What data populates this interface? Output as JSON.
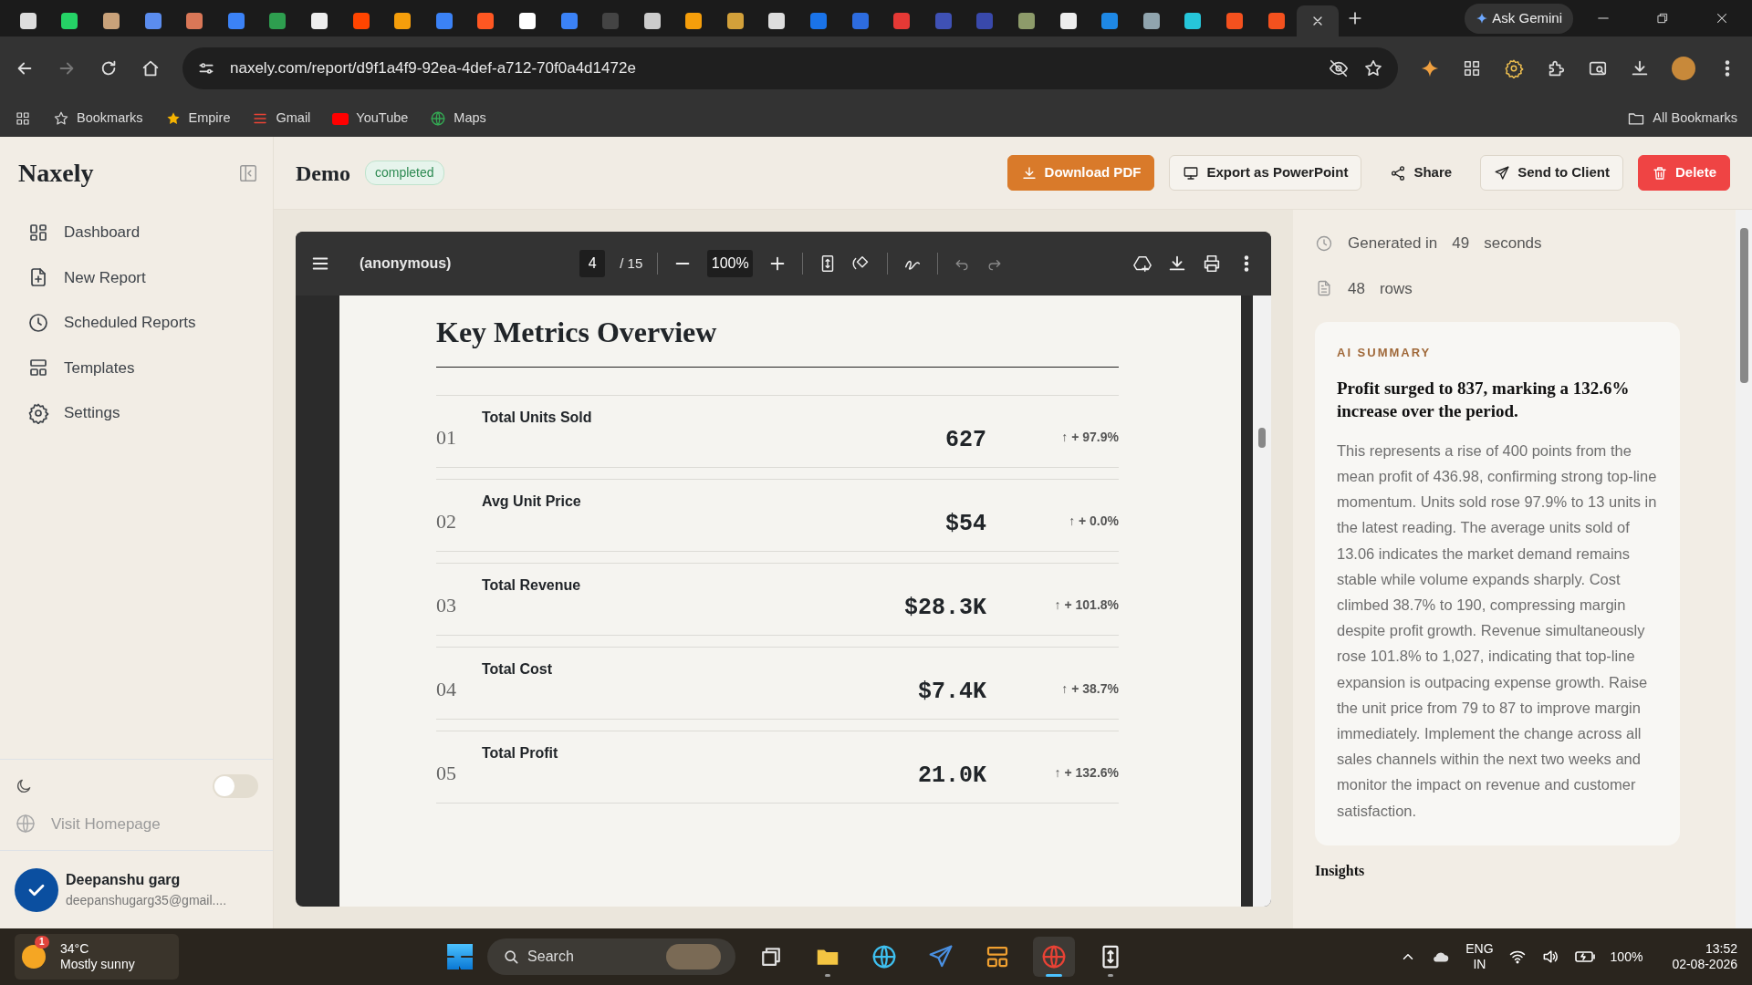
{
  "browser": {
    "tabs": [
      {
        "selected": false
      },
      {
        "selected": false
      },
      {
        "selected": false
      },
      {
        "selected": false
      },
      {
        "selected": false
      },
      {
        "selected": false
      },
      {
        "selected": false
      },
      {
        "selected": false
      },
      {
        "selected": false
      },
      {
        "selected": false
      },
      {
        "selected": false
      },
      {
        "selected": false
      },
      {
        "selected": false
      },
      {
        "selected": false
      },
      {
        "selected": false
      },
      {
        "selected": false
      },
      {
        "selected": false
      },
      {
        "selected": false
      },
      {
        "selected": false
      },
      {
        "selected": false
      },
      {
        "selected": false
      },
      {
        "selected": false
      },
      {
        "selected": false
      },
      {
        "selected": false
      },
      {
        "selected": false
      },
      {
        "selected": false
      },
      {
        "selected": false
      },
      {
        "selected": false
      },
      {
        "selected": false
      },
      {
        "selected": false
      },
      {
        "selected": false
      },
      {
        "selected": true
      }
    ],
    "gemini_button": "Ask Gemini",
    "url": "naxely.com/report/d9f1a4f9-92ea-4def-a712-70f0a4d1472e",
    "bookmarks": [
      "Bookmarks",
      "Empire",
      "Gmail",
      "YouTube",
      "Maps"
    ],
    "all_bookmarks": "All Bookmarks"
  },
  "sidebar": {
    "brand": "Naxely",
    "items": [
      {
        "label": "Dashboard",
        "selected": false
      },
      {
        "label": "New Report",
        "selected": false
      },
      {
        "label": "Scheduled Reports",
        "selected": false
      },
      {
        "label": "Templates",
        "selected": false
      },
      {
        "label": "Settings",
        "selected": false
      }
    ],
    "dark_mode": {
      "on": false
    },
    "visit_homepage": "Visit Homepage",
    "user": {
      "name": "Deepanshu garg",
      "email": "deepanshugarg35@gmail...."
    }
  },
  "header": {
    "title": "Demo",
    "status": "completed",
    "actions": [
      {
        "label": "Download PDF",
        "kind": "primary"
      },
      {
        "label": "Export as PowerPoint",
        "kind": "outline"
      },
      {
        "label": "Share",
        "kind": "plain"
      },
      {
        "label": "Send to Client",
        "kind": "outline"
      },
      {
        "label": "Delete",
        "kind": "danger"
      }
    ]
  },
  "pdf_viewer": {
    "title": "(anonymous)",
    "page": "4",
    "page_count": "/ 15",
    "zoom": "100%",
    "page_content": {
      "heading": "Key Metrics Overview",
      "metrics": [
        {
          "index": "01",
          "label": "Total Units Sold",
          "value": "627",
          "change": "↑ + 97.9%"
        },
        {
          "index": "02",
          "label": "Avg Unit Price",
          "value": "$54",
          "change": "↑ + 0.0%"
        },
        {
          "index": "03",
          "label": "Total Revenue",
          "value": "$28.3K",
          "change": "↑ + 101.8%"
        },
        {
          "index": "04",
          "label": "Total Cost",
          "value": "$7.4K",
          "change": "↑ + 38.7%"
        },
        {
          "index": "05",
          "label": "Total Profit",
          "value": "21.0K",
          "change": "↑ + 132.6%"
        }
      ]
    }
  },
  "details": {
    "generated": {
      "label": "Generated in",
      "value": "49",
      "unit": "seconds"
    },
    "rows": {
      "value": "48",
      "unit": "rows"
    },
    "summary": {
      "label": "AI SUMMARY",
      "headline": "Profit surged to 837, marking a 132.6% increase over the period.",
      "body": "This represents a rise of 400 points from the mean profit of 436.98, confirming strong top-line momentum. Units sold rose 97.9% to 13 units in the latest reading. The average units sold of 13.06 indicates the market demand remains stable while volume expands sharply. Cost climbed 38.7% to 190, compressing margin despite profit growth. Revenue simultaneously rose 101.8% to 1,027, indicating that top-line expansion is outpacing expense growth. Raise the unit price from 79 to 87 to improve margin immediately. Implement the change across all sales channels within the next two weeks and monitor the impact on revenue and customer satisfaction."
    },
    "next_heading": "Insights"
  },
  "taskbar": {
    "weather": {
      "badge": "1",
      "temp": "34°C",
      "text": "Mostly sunny"
    },
    "search": "Search",
    "apps": [
      {
        "running": false,
        "selected": false
      },
      {
        "running": true,
        "selected": false
      },
      {
        "running": false,
        "selected": false
      },
      {
        "running": false,
        "selected": false
      },
      {
        "running": false,
        "selected": false
      },
      {
        "running": true,
        "selected": true
      },
      {
        "running": true,
        "selected": false
      }
    ],
    "tray": {
      "lang": "ENG",
      "region": "IN",
      "battery": "100%",
      "time": "13:52",
      "date": "02-08-2026"
    }
  }
}
